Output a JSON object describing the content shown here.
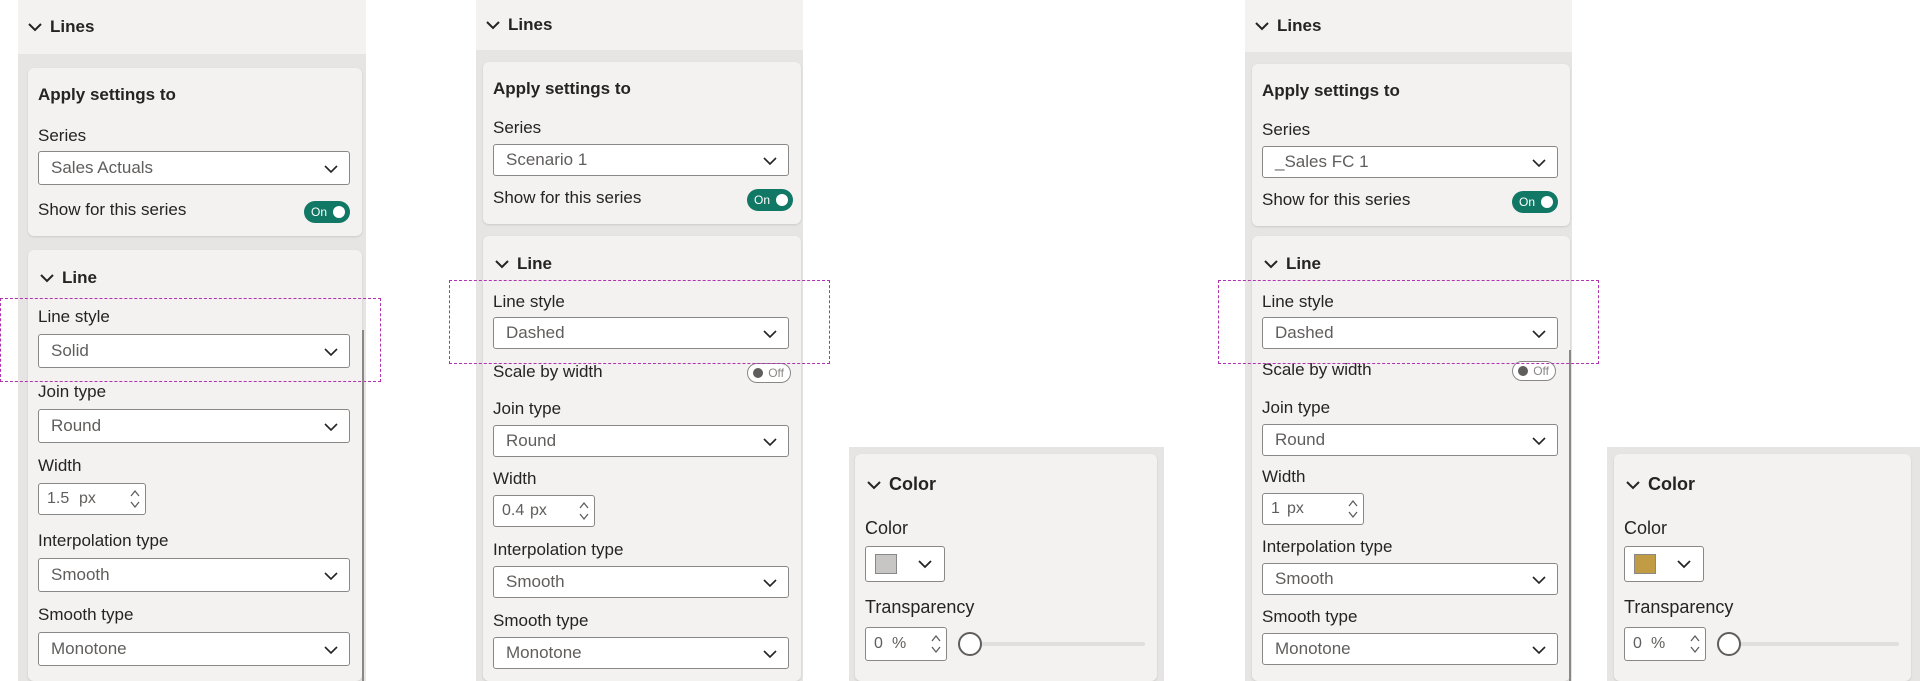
{
  "panels": [
    {
      "lines_header": "Lines",
      "apply_title": "Apply settings to",
      "series_label": "Series",
      "series_value": "Sales Actuals",
      "show_label": "Show for this series",
      "toggle": "On",
      "line_header": "Line",
      "line_style_label": "Line style",
      "line_style_value": "Solid",
      "join_label": "Join type",
      "join_value": "Round",
      "width_label": "Width",
      "width_value": "1.5",
      "width_unit": "px",
      "interp_label": "Interpolation type",
      "interp_value": "Smooth",
      "smooth_label": "Smooth type",
      "smooth_value": "Monotone"
    },
    {
      "lines_header": "Lines",
      "apply_title": "Apply settings to",
      "series_label": "Series",
      "series_value": "Scenario 1",
      "show_label": "Show for this series",
      "toggle": "On",
      "line_header": "Line",
      "line_style_label": "Line style",
      "line_style_value": "Dashed",
      "scale_label": "Scale by width",
      "scale_toggle": "Off",
      "join_label": "Join type",
      "join_value": "Round",
      "width_label": "Width",
      "width_value": "0.4",
      "width_unit": "px",
      "interp_label": "Interpolation type",
      "interp_value": "Smooth",
      "smooth_label": "Smooth type",
      "smooth_value": "Monotone"
    },
    {
      "lines_header": "Lines",
      "apply_title": "Apply settings to",
      "series_label": "Series",
      "series_value": "_Sales FC 1",
      "show_label": "Show for this series",
      "toggle": "On",
      "line_header": "Line",
      "line_style_label": "Line style",
      "line_style_value": "Dashed",
      "scale_label": "Scale by width",
      "scale_toggle": "Off",
      "join_label": "Join type",
      "join_value": "Round",
      "width_label": "Width",
      "width_value": "1",
      "width_unit": "px",
      "interp_label": "Interpolation type",
      "interp_value": "Smooth",
      "smooth_label": "Smooth type",
      "smooth_value": "Monotone"
    }
  ],
  "color_panels": [
    {
      "header": "Color",
      "color_label": "Color",
      "swatch": "#c8c6c4",
      "transparency_label": "Transparency",
      "transparency_value": "0",
      "transparency_unit": "%",
      "transparency_percent": 0
    },
    {
      "header": "Color",
      "color_label": "Color",
      "swatch": "#c19c45",
      "transparency_label": "Transparency",
      "transparency_value": "0",
      "transparency_unit": "%",
      "transparency_percent": 0
    }
  ],
  "colors": {
    "toggle_on": "#117865",
    "highlight": "#b032b0",
    "panel_bg": "#f3f2f1"
  }
}
